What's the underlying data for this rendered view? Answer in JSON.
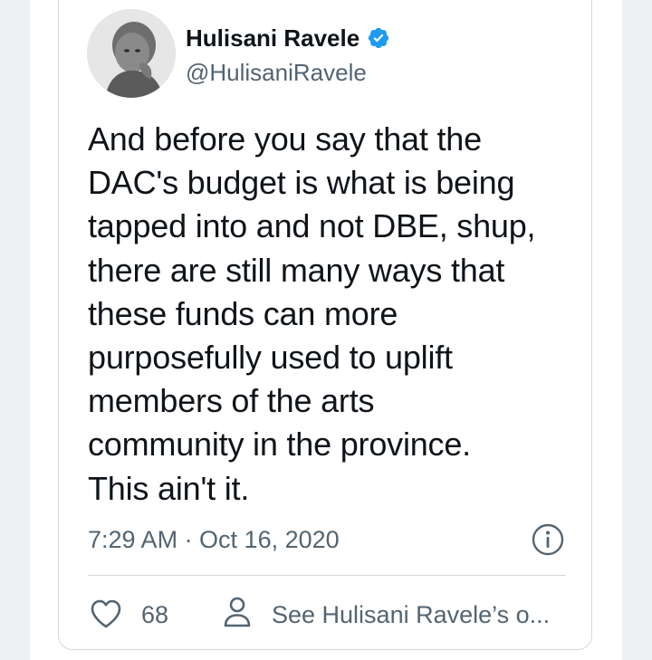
{
  "tweet": {
    "author_name": "Hulisani Ravele",
    "author_handle": "@HulisaniRavele",
    "verified": true,
    "text": "And before you say that the\nDAC's budget is what is being\ntapped into and not DBE, shup,\nthere are still many ways that\nthese funds can more\npurposefully used to uplift\nmembers of the arts\ncommunity in the province.\nThis ain't it.",
    "timestamp": "7:29 AM · Oct 16, 2020",
    "likes_count": "68",
    "see_more_label": "See Hulisani Ravele’s o..."
  },
  "icons": {
    "verified": "verified-badge-icon",
    "info": "info-icon",
    "like": "heart-icon",
    "profile": "person-icon"
  },
  "colors": {
    "verified_blue": "#1d9bf0",
    "text_primary": "#0f1419",
    "text_secondary": "#536471",
    "border": "#cfd9de",
    "background": "#eef1f3"
  }
}
